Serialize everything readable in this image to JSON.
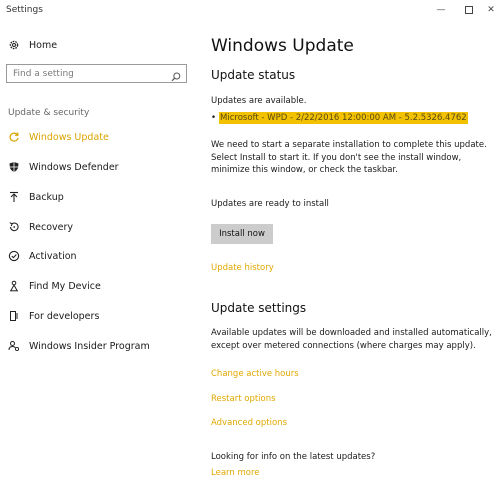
{
  "window": {
    "title": "Settings",
    "minimize_glyph": "—",
    "close_glyph": "✕"
  },
  "sidebar": {
    "home_label": "Home",
    "search_placeholder": "Find a setting",
    "section_label": "Update & security",
    "items": [
      {
        "label": "Windows Update",
        "icon": "refresh-icon",
        "active": true
      },
      {
        "label": "Windows Defender",
        "icon": "shield-icon",
        "active": false
      },
      {
        "label": "Backup",
        "icon": "backup-arrow-icon",
        "active": false
      },
      {
        "label": "Recovery",
        "icon": "recovery-icon",
        "active": false
      },
      {
        "label": "Activation",
        "icon": "check-circle-icon",
        "active": false
      },
      {
        "label": "Find My Device",
        "icon": "person-pin-icon",
        "active": false
      },
      {
        "label": "For developers",
        "icon": "developer-icon",
        "active": false
      },
      {
        "label": "Windows Insider Program",
        "icon": "insider-icon",
        "active": false
      }
    ]
  },
  "main": {
    "title": "Windows Update",
    "status_heading": "Update status",
    "updates_available": "Updates are available.",
    "update_item": "Microsoft - WPD - 2/22/2016 12:00:00 AM - 5.2.5326.4762",
    "install_note": "We need to start a separate installation to complete this update. Select Install to start it. If you don't see the install window, minimize this window, or check the taskbar.",
    "ready_text": "Updates are ready to install",
    "install_button": "Install now",
    "history_link": "Update history",
    "settings_heading": "Update settings",
    "settings_desc": "Available updates will be downloaded and installed automatically, except over metered connections (where charges may apply).",
    "link_active_hours": "Change active hours",
    "link_restart": "Restart options",
    "link_advanced": "Advanced options",
    "info_text": "Looking for info on the latest updates?",
    "learn_more": "Learn more"
  },
  "colors": {
    "accent": "#e0a800",
    "highlight": "#f2c100",
    "button": "#cccccc"
  }
}
